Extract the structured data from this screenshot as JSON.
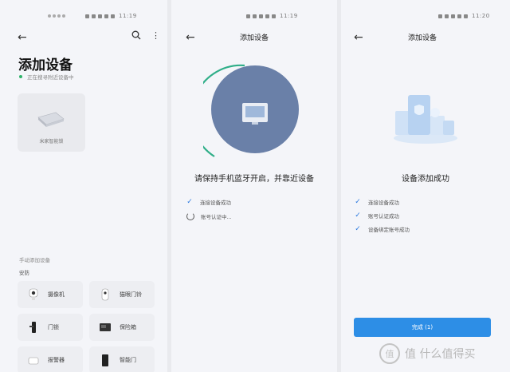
{
  "status": {
    "time1": "11:19",
    "time2": "11:19",
    "time3": "11:20"
  },
  "screen1": {
    "title": "添加设备",
    "scanning": "正在搜寻附近设备中",
    "found_device": "米家智能锁",
    "manual_section": "手动添加设备",
    "category": "安防",
    "tiles": [
      "摄像机",
      "猫眼门铃",
      "门锁",
      "保险箱",
      "报警器",
      "智能门"
    ]
  },
  "screen2": {
    "header": "添加设备",
    "message": "请保持手机蓝牙开启，并靠近设备",
    "steps": [
      "连接设备成功",
      "账号认证中..."
    ]
  },
  "screen3": {
    "header": "添加设备",
    "message": "设备添加成功",
    "steps": [
      "连接设备成功",
      "账号认证成功",
      "设备绑定账号成功"
    ],
    "done_button": "完成 (1)"
  },
  "watermark": "值 什么值得买",
  "colors": {
    "accent": "#2d8ee6",
    "circle": "#6a80a8",
    "check": "#2d7be0"
  }
}
